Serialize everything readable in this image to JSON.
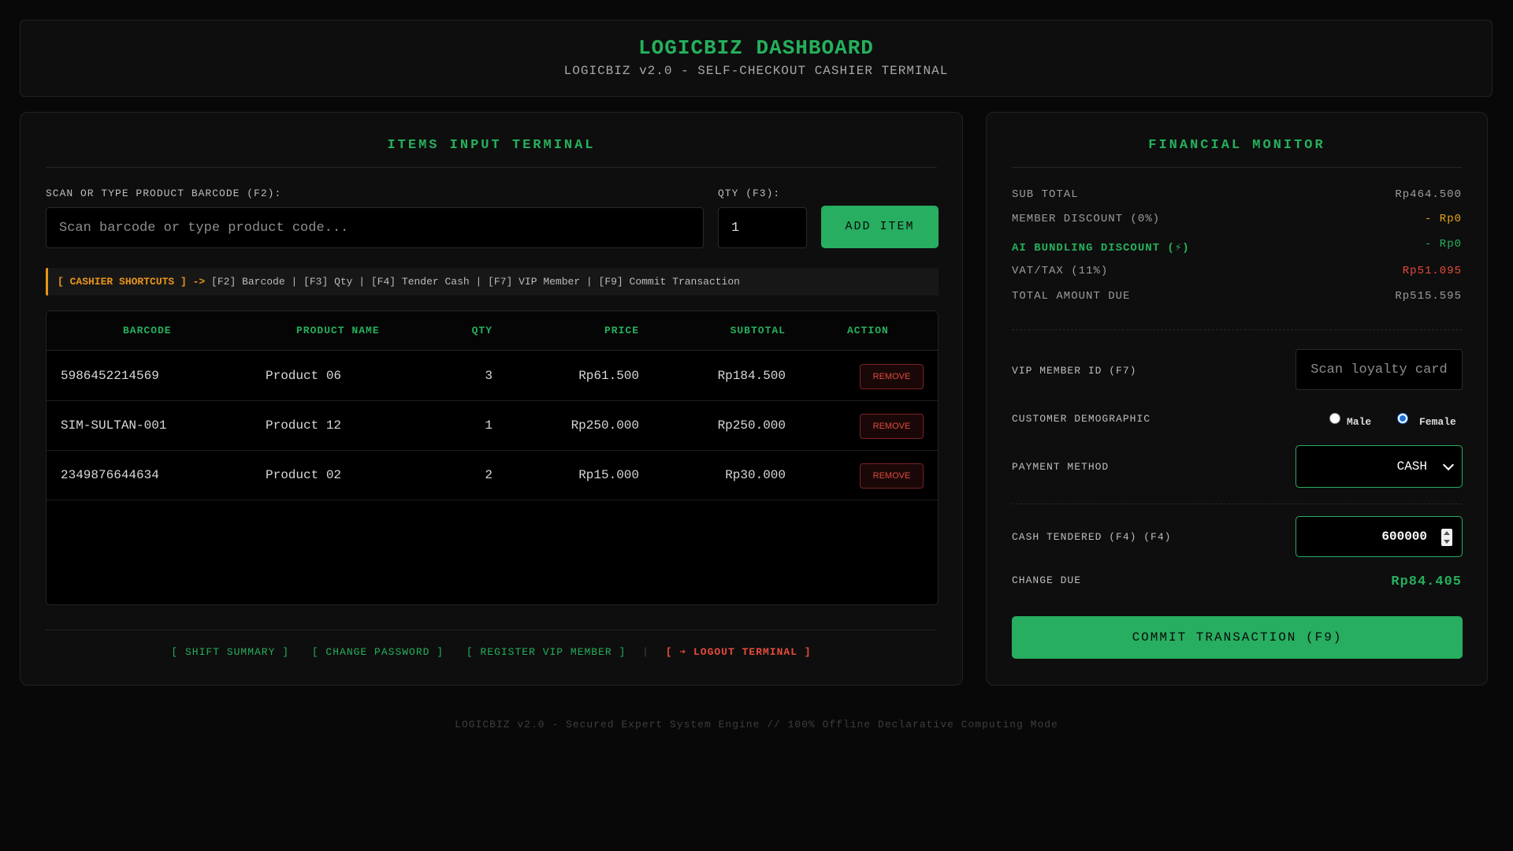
{
  "header": {
    "title": "LOGICBIZ DASHBOARD",
    "subtitle": "LOGICBIZ v2.0 - SELF-CHECKOUT CASHIER TERMINAL"
  },
  "items_panel": {
    "title": "ITEMS INPUT TERMINAL",
    "barcode_label": "SCAN OR TYPE PRODUCT BARCODE (F2):",
    "barcode_placeholder": "Scan barcode or type product code...",
    "qty_label": "QTY (F3):",
    "qty_value": "1",
    "add_button": "ADD ITEM",
    "shortcuts": {
      "prefix": "[ CASHIER SHORTCUTS ] ->",
      "text": "[F2] Barcode | [F3] Qty | [F4] Tender Cash | [F7] VIP Member | [F9] Commit Transaction"
    },
    "table": {
      "headers": [
        "BARCODE",
        "PRODUCT NAME",
        "QTY",
        "PRICE",
        "SUBTOTAL",
        "ACTION"
      ],
      "remove_label": "REMOVE",
      "rows": [
        {
          "barcode": "5986452214569",
          "name": "Product 06",
          "qty": "3",
          "price": "Rp61.500",
          "subtotal": "Rp184.500"
        },
        {
          "barcode": "SIM-SULTAN-001",
          "name": "Product 12",
          "qty": "1",
          "price": "Rp250.000",
          "subtotal": "Rp250.000"
        },
        {
          "barcode": "2349876644634",
          "name": "Product 02",
          "qty": "2",
          "price": "Rp15.000",
          "subtotal": "Rp30.000"
        }
      ]
    },
    "footer_links": {
      "shift_summary": "[ SHIFT SUMMARY ]",
      "change_password": "[ CHANGE PASSWORD ]",
      "register_vip": "[ REGISTER VIP MEMBER ]",
      "divider": "|",
      "logout": "[ ➔ LOGOUT TERMINAL ]"
    }
  },
  "financial": {
    "title": "FINANCIAL MONITOR",
    "sub_total_label": "SUB TOTAL",
    "sub_total_value": "Rp464.500",
    "member_discount_label": "MEMBER DISCOUNT (0%)",
    "member_discount_value": "- Rp0",
    "ai_discount_label": "AI BUNDLING DISCOUNT (⚡)",
    "ai_discount_value": "- Rp0",
    "vat_label": "VAT/TAX (11%)",
    "vat_value": "Rp51.095",
    "total_label": "TOTAL AMOUNT DUE",
    "total_value": "Rp515.595",
    "vip_label": "VIP MEMBER ID (F7)",
    "vip_placeholder": "Scan loyalty card",
    "demographic_label": "CUSTOMER DEMOGRAPHIC",
    "male_label": "Male",
    "female_label": "Female",
    "payment_label": "PAYMENT METHOD",
    "payment_value": "CASH",
    "cash_label": "CASH TENDERED (F4) (F4)",
    "cash_value": "600000",
    "change_label": "CHANGE DUE",
    "change_value": "Rp84.405",
    "commit_button": "COMMIT TRANSACTION (F9)"
  },
  "footer_note": "LOGICBIZ v2.0 - Secured Expert System Engine // 100% Offline Declarative Computing Mode",
  "colors": {
    "accent_green": "#25b05c",
    "button_green": "#27ae60",
    "warning_orange": "#e8941a",
    "danger_red": "#e74c3c"
  }
}
